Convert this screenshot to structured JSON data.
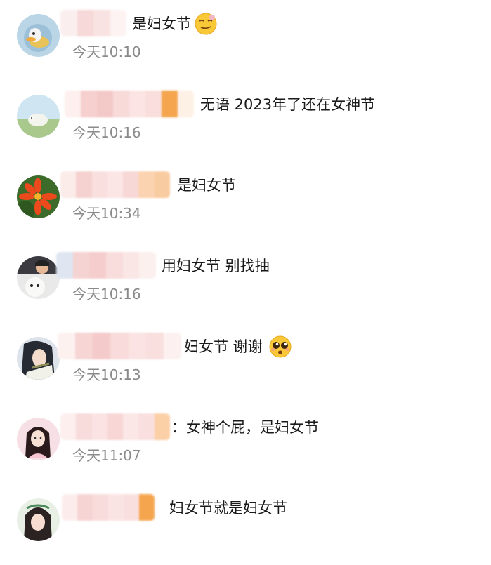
{
  "comments": [
    {
      "text": "是妇女节",
      "time": "今天10:10",
      "emoji": "smirk-face-emoji"
    },
    {
      "text": "无语 2023年了还在女神节",
      "time": "今天10:16",
      "emoji": ""
    },
    {
      "text": "是妇女节",
      "time": "今天10:34",
      "emoji": ""
    },
    {
      "text": "用妇女节 别找抽",
      "time": "今天10:16",
      "emoji": ""
    },
    {
      "text": "妇女节 谢谢",
      "time": "今天10:13",
      "emoji": "pleading-face-emoji"
    },
    {
      "text": "：女神个屁，是妇女节",
      "time": "今天11:07",
      "emoji": ""
    },
    {
      "text": "妇女节就是妇女节",
      "time": "",
      "emoji": ""
    }
  ],
  "colors": {
    "text": "#1a1a1a",
    "timestamp": "#8a8a8a",
    "blur_pink": "#f6d4d2",
    "blur_light": "#fbecea",
    "blur_orange": "#f4a54e"
  }
}
